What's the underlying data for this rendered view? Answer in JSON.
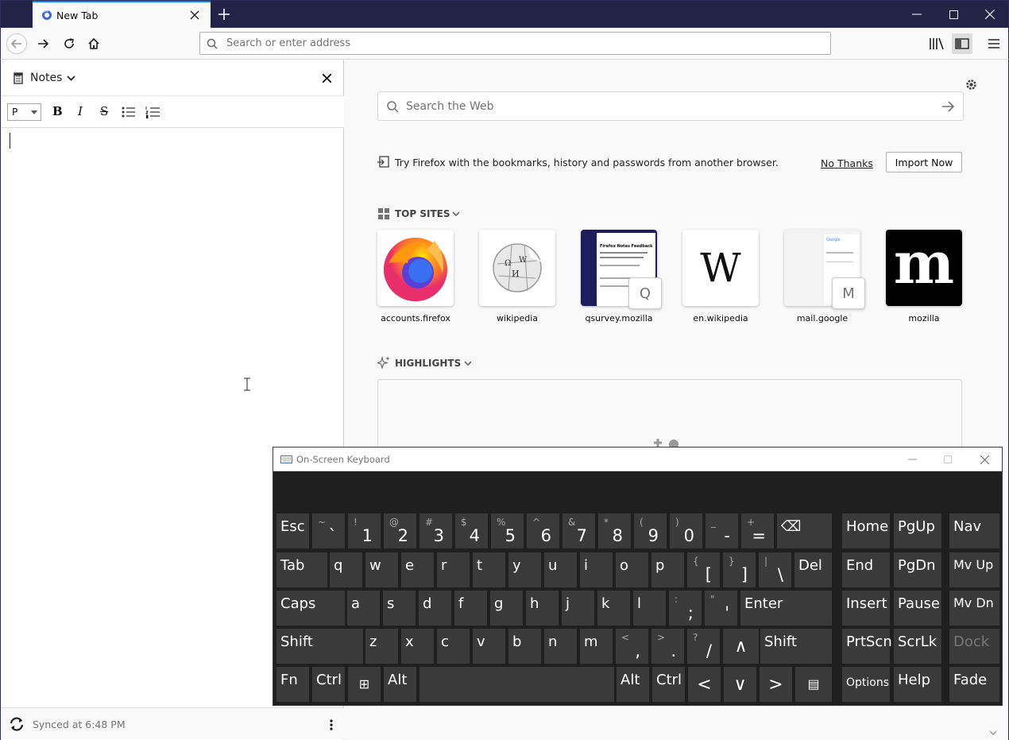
{
  "browser": {
    "tab_title": "New Tab",
    "url_placeholder": "Search or enter address"
  },
  "sidebar": {
    "title": "Notes",
    "format_select": "P",
    "footer_status": "Synced at 6:48 PM"
  },
  "newtab": {
    "search_placeholder": "Search the Web",
    "import_message": "Try Firefox with the bookmarks, history and passwords from another browser.",
    "no_thanks": "No Thanks",
    "import_now": "Import Now",
    "top_sites_title": "TOP SITES",
    "highlights_title": "HIGHLIGHTS",
    "top_sites": [
      {
        "label": "accounts.firefox",
        "icon": "firefox-logo"
      },
      {
        "label": "wikipedia",
        "icon": "wikipedia-globe"
      },
      {
        "label": "qsurvey.mozilla",
        "icon": "survey-screenshot",
        "badge": "Q",
        "preview_title": "Firefox Notes Feedback"
      },
      {
        "label": "en.wikipedia",
        "icon": "wikipedia-w",
        "glyph": "W"
      },
      {
        "label": "mail.google",
        "icon": "gmail-screenshot",
        "badge": "M",
        "preview_title": "Google"
      },
      {
        "label": "mozilla",
        "icon": "mozilla-m",
        "glyph": "m"
      }
    ]
  },
  "osk": {
    "title": "On-Screen Keyboard",
    "rows": [
      [
        {
          "m": "Esc"
        },
        {
          "s": "~",
          "b": "`"
        },
        {
          "s": "!",
          "b": "1"
        },
        {
          "s": "@",
          "b": "2"
        },
        {
          "s": "#",
          "b": "3"
        },
        {
          "s": "$",
          "b": "4"
        },
        {
          "s": "%",
          "b": "5"
        },
        {
          "s": "^",
          "b": "6"
        },
        {
          "s": "&",
          "b": "7"
        },
        {
          "s": "*",
          "b": "8"
        },
        {
          "s": "(",
          "b": "9"
        },
        {
          "s": ")",
          "b": "0"
        },
        {
          "s": "_",
          "b": "-"
        },
        {
          "s": "+",
          "b": "="
        },
        {
          "m": "⌫"
        },
        {
          "m": "Home"
        },
        {
          "m": "PgUp"
        },
        {
          "m": "Nav"
        }
      ],
      [
        {
          "m": "Tab"
        },
        {
          "m": "q"
        },
        {
          "m": "w"
        },
        {
          "m": "e"
        },
        {
          "m": "r"
        },
        {
          "m": "t"
        },
        {
          "m": "y"
        },
        {
          "m": "u"
        },
        {
          "m": "i"
        },
        {
          "m": "o"
        },
        {
          "m": "p"
        },
        {
          "s": "{",
          "b": "["
        },
        {
          "s": "}",
          "b": "]"
        },
        {
          "s": "|",
          "b": "\\"
        },
        {
          "m": "Del"
        },
        {
          "m": "End"
        },
        {
          "m": "PgDn"
        },
        {
          "m": "Mv Up"
        }
      ],
      [
        {
          "m": "Caps"
        },
        {
          "m": "a"
        },
        {
          "m": "s"
        },
        {
          "m": "d"
        },
        {
          "m": "f"
        },
        {
          "m": "g"
        },
        {
          "m": "h"
        },
        {
          "m": "j"
        },
        {
          "m": "k"
        },
        {
          "m": "l"
        },
        {
          "s": ":",
          "b": ";"
        },
        {
          "s": "\"",
          "b": "'"
        },
        {
          "m": "Enter"
        },
        {
          "m": "Insert"
        },
        {
          "m": "Pause"
        },
        {
          "m": "Mv Dn"
        }
      ],
      [
        {
          "m": "Shift"
        },
        {
          "m": "z"
        },
        {
          "m": "x"
        },
        {
          "m": "c"
        },
        {
          "m": "v"
        },
        {
          "m": "b"
        },
        {
          "m": "n"
        },
        {
          "m": "m"
        },
        {
          "s": "<",
          "b": ","
        },
        {
          "s": ">",
          "b": "."
        },
        {
          "s": "?",
          "b": "/"
        },
        {
          "m": "∧"
        },
        {
          "m": "Shift"
        },
        {
          "m": "PrtScn"
        },
        {
          "m": "ScrLk"
        },
        {
          "m": "Dock",
          "dim": true
        }
      ],
      [
        {
          "m": "Fn"
        },
        {
          "m": "Ctrl"
        },
        {
          "m": "⊞"
        },
        {
          "m": "Alt"
        },
        {
          "m": ""
        },
        {
          "m": "Alt"
        },
        {
          "m": "Ctrl"
        },
        {
          "m": "<"
        },
        {
          "m": "∨"
        },
        {
          "m": ">"
        },
        {
          "m": "▤"
        },
        {
          "m": "Options"
        },
        {
          "m": "Help"
        },
        {
          "m": "Fade"
        }
      ]
    ]
  }
}
